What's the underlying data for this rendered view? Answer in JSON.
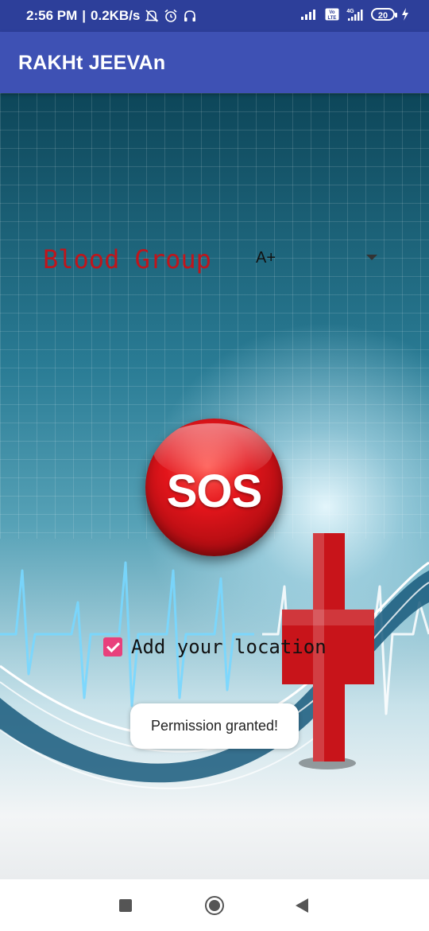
{
  "status_bar": {
    "time": "2:56 PM",
    "speed": "0.2KB/s",
    "separator": "|",
    "battery": "20",
    "network_label": "4G",
    "volte_label": "Vo LTE",
    "icons": [
      "mute-icon",
      "alarm-icon",
      "headphones-icon",
      "signal-icon",
      "volte-icon",
      "4g-signal-icon",
      "battery-icon",
      "charging-icon"
    ]
  },
  "app_bar": {
    "title": "RAKHt JEEVAn"
  },
  "form": {
    "blood_group_label": "Blood Group",
    "blood_group_value": "A+",
    "sos_label": "SOS",
    "location_label": "Add your location",
    "location_checked": true
  },
  "toast": {
    "message": "Permission granted!"
  },
  "nav_bar": {
    "icons": [
      "recents-icon",
      "home-icon",
      "back-icon"
    ]
  },
  "colors": {
    "status_bar": "#2d3f9a",
    "app_bar": "#3e51b4",
    "blood_label": "#c0151b",
    "sos_red": "#e3151b",
    "checkbox": "#e8407c"
  }
}
